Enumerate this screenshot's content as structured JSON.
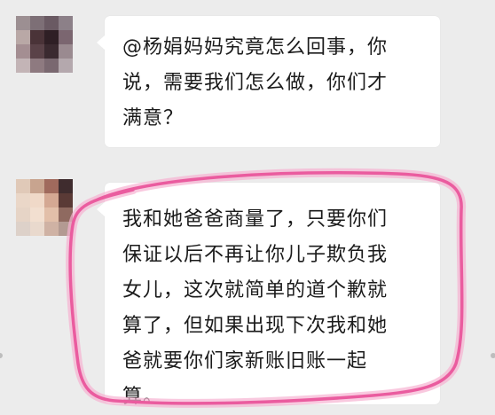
{
  "chat": {
    "messages": [
      {
        "sender_avatar": "blurred-profile-photo",
        "text": "@杨娟妈妈究竟怎么回事，你\n说，需要我们怎么做，你们才\n满意？"
      },
      {
        "sender_avatar": "blurred-profile-photo",
        "text": "我和她爸爸商量了，只要你们\n保证以后不再让你儿子欺负我\n女儿，这次就简单的道个歉就\n算了，但如果出现下次我和她\n爸就要你们家新账旧账一起\n算。"
      }
    ]
  },
  "colors": {
    "background": "#ececec",
    "bubble": "#ffffff",
    "highlight_stroke": "#ea5c9f",
    "highlight_glow": "#f7b2d2"
  }
}
